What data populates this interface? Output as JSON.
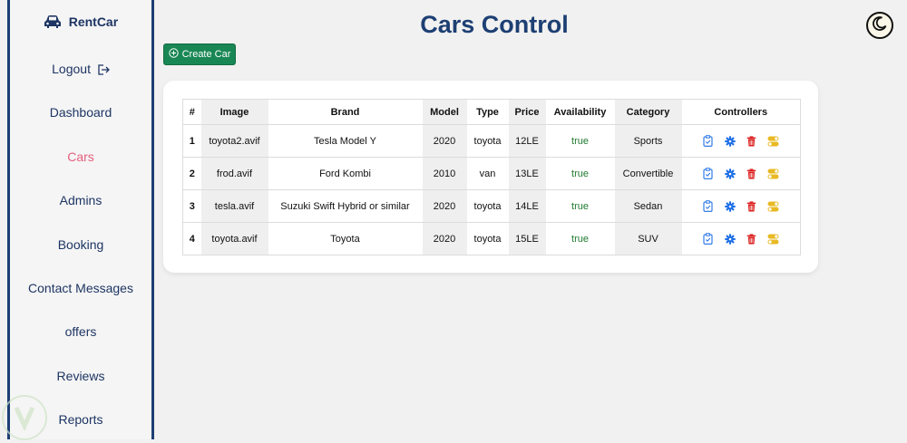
{
  "sidebar": {
    "brand": "RentCar",
    "items": [
      {
        "label": "Logout",
        "name": "sidebar-item-logout"
      },
      {
        "label": "Dashboard",
        "name": "sidebar-item-dashboard"
      },
      {
        "label": "Cars",
        "name": "sidebar-item-cars",
        "active": true
      },
      {
        "label": "Admins",
        "name": "sidebar-item-admins"
      },
      {
        "label": "Booking",
        "name": "sidebar-item-booking"
      },
      {
        "label": "Contact Messages",
        "name": "sidebar-item-contact-messages"
      },
      {
        "label": "offers",
        "name": "sidebar-item-offers"
      },
      {
        "label": "Reviews",
        "name": "sidebar-item-reviews"
      },
      {
        "label": "Reports",
        "name": "sidebar-item-reports"
      }
    ]
  },
  "header": {
    "title": "Cars Control",
    "theme_icon": "moon-icon"
  },
  "toolbar": {
    "create_label": "Create Car"
  },
  "table": {
    "columns": [
      "#",
      "Image",
      "Brand",
      "Model",
      "Type",
      "Price",
      "Availability",
      "Category",
      "Controllers"
    ],
    "rows": [
      [
        "1",
        "toyota2.avif",
        "Tesla Model Y",
        "2020",
        "toyota",
        "12LE",
        "true",
        "Sports"
      ],
      [
        "2",
        "frod.avif",
        "Ford Kombi",
        "2010",
        "van",
        "13LE",
        "true",
        "Convertible"
      ],
      [
        "3",
        "tesla.avif",
        "Suzuki Swift Hybrid or similar",
        "2020",
        "toyota",
        "14LE",
        "true",
        "Sedan"
      ],
      [
        "4",
        "toyota.avif",
        "Toyota",
        "2020",
        "toyota",
        "15LE",
        "true",
        "SUV"
      ]
    ],
    "controller_icons": [
      "clipboard-icon",
      "gear-icon",
      "trash-icon",
      "toggle-icon"
    ]
  },
  "colors": {
    "primary": "#1d3f73",
    "active": "#e4607e",
    "success": "#198754",
    "view": "#1e6fe6",
    "delete": "#dc1f1f",
    "toggle": "#e8b923"
  }
}
